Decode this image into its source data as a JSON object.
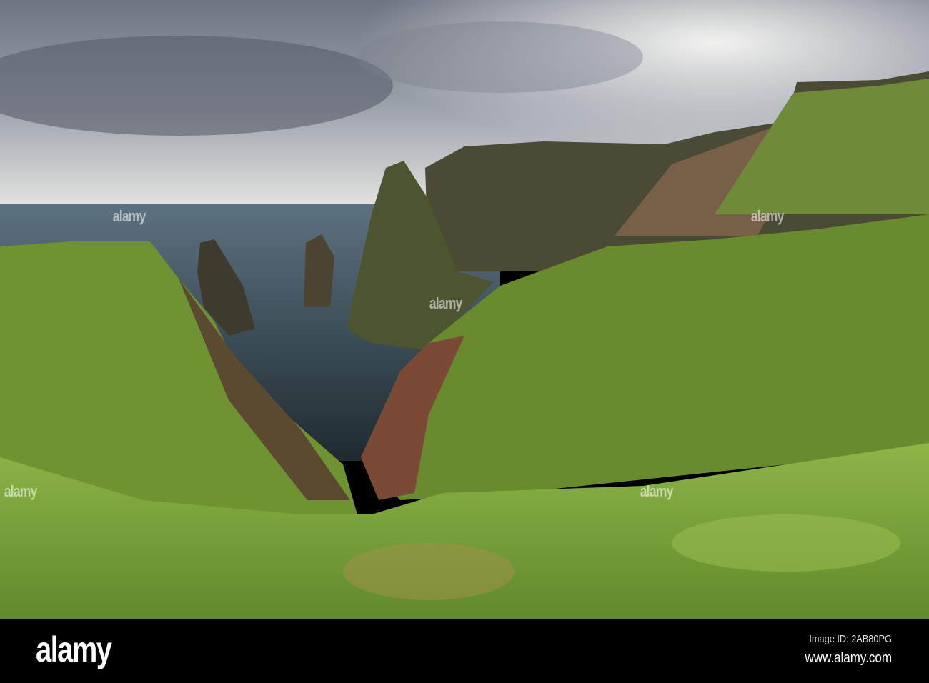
{
  "photo": {
    "subject": "coastal-cliffs-sea-stacks",
    "watermark": "alamy"
  },
  "footer": {
    "logo": "alamy",
    "image_id": "Image ID: 2AB80PG",
    "website": "www.alamy.com"
  },
  "colors": {
    "sky": "#c9ccd2",
    "sea": "#33434c",
    "grass": "#7fa53a",
    "rock": "#6b5a3f",
    "bar": "#000000"
  }
}
